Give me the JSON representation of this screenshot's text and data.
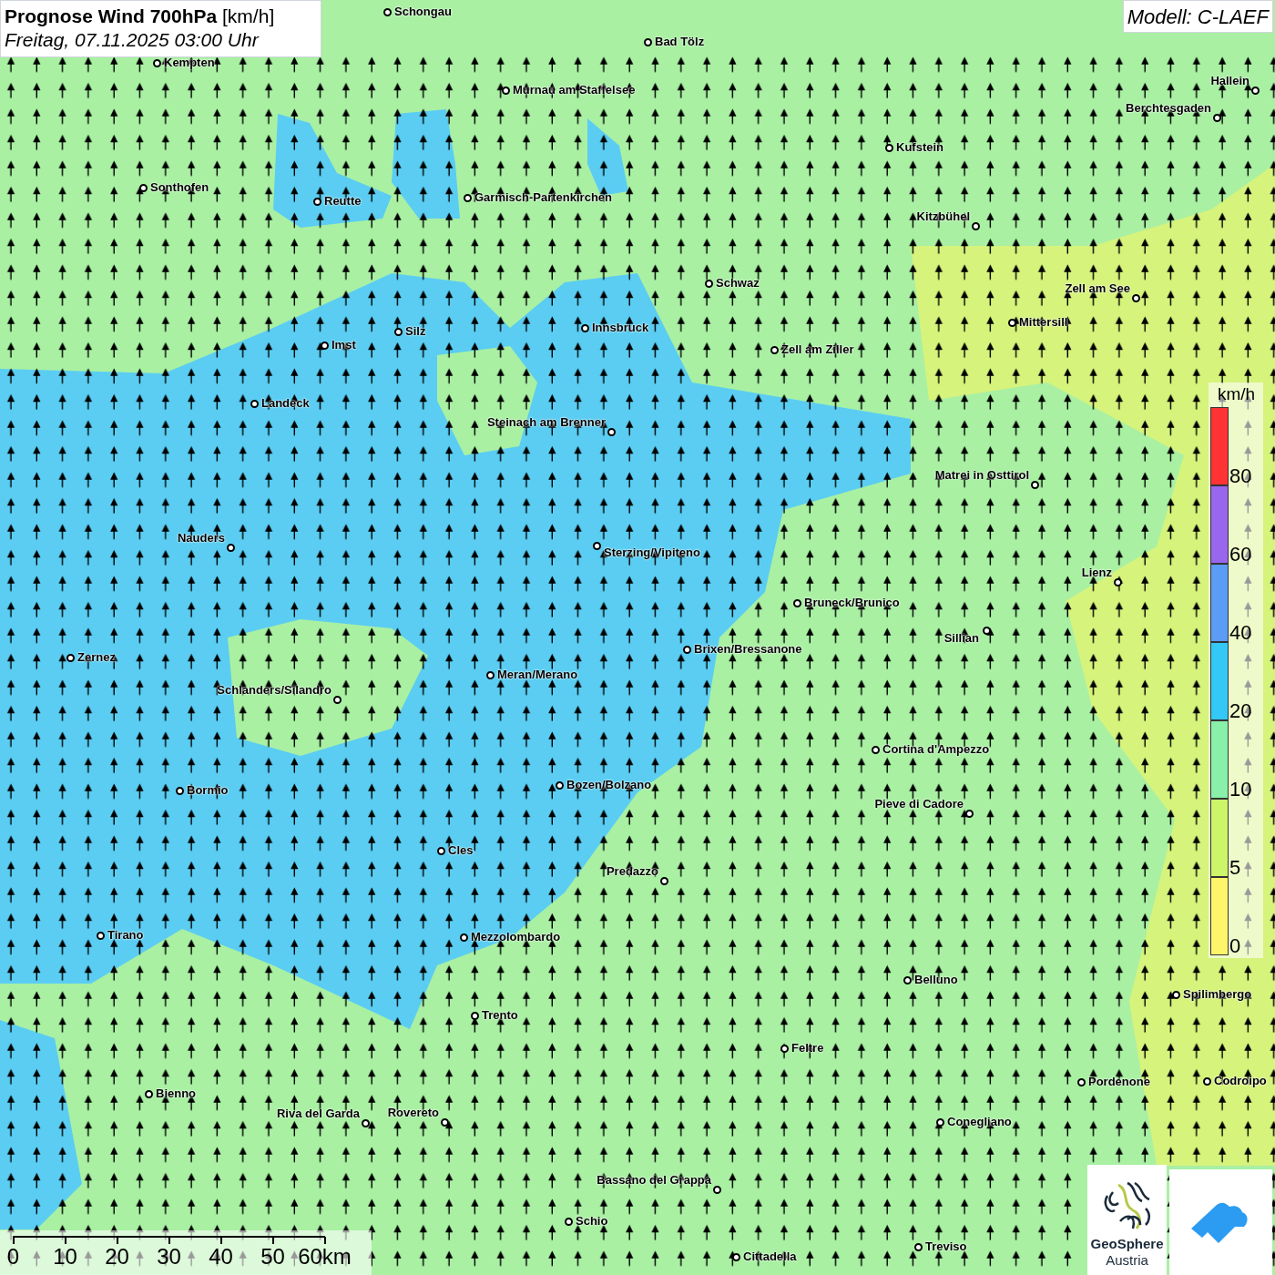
{
  "title": "**Prognose Wind 700hPa** [km/h]",
  "subtitle": "Freitag, 07.11.2025 03:00 Uhr",
  "model": "Modell: C-LAEF",
  "places": [
    {
      "name": "Schongau"
    },
    {
      "name": "Bad Tölz"
    },
    {
      "name": "Kempten"
    },
    {
      "name": "Murnau am Staffelsee"
    },
    {
      "name": "Hallein"
    },
    {
      "name": "Berchtesgaden"
    },
    {
      "name": "Kufstein"
    },
    {
      "name": "Sonthofen"
    },
    {
      "name": "Reutte"
    },
    {
      "name": "Garmisch-Partenkirchen"
    },
    {
      "name": "Kitzbühel"
    },
    {
      "name": "Schwaz"
    },
    {
      "name": "Zell am See"
    },
    {
      "name": "Mittersill"
    },
    {
      "name": "Silz"
    },
    {
      "name": "Innsbruck"
    },
    {
      "name": "Imst"
    },
    {
      "name": "Zell am Ziller"
    },
    {
      "name": "Landeck"
    },
    {
      "name": "Steinach am Brenner"
    },
    {
      "name": "Matrei in Osttirol"
    },
    {
      "name": "Nauders"
    },
    {
      "name": "Sterzing/Vipiteno"
    },
    {
      "name": "Lienz"
    },
    {
      "name": "Bruneck/Brunico"
    },
    {
      "name": "Sillian"
    },
    {
      "name": "Brixen/Bressanone"
    },
    {
      "name": "Zernez"
    },
    {
      "name": "Meran/Merano"
    },
    {
      "name": "Schlanders/Silandro"
    },
    {
      "name": "Cortina d'Ampezzo"
    },
    {
      "name": "Bozen/Bolzano"
    },
    {
      "name": "Bormio"
    },
    {
      "name": "Pieve di Cadore"
    },
    {
      "name": "Cles"
    },
    {
      "name": "Predazzo"
    },
    {
      "name": "Tirano"
    },
    {
      "name": "Mezzolombardo"
    },
    {
      "name": "Belluno"
    },
    {
      "name": "Spilimbergo"
    },
    {
      "name": "Trento"
    },
    {
      "name": "Feltre"
    },
    {
      "name": "Pordenone"
    },
    {
      "name": "Codroipo"
    },
    {
      "name": "Bienno"
    },
    {
      "name": "Riva del Garda"
    },
    {
      "name": "Rovereto"
    },
    {
      "name": "Conegliano"
    },
    {
      "name": "Bassano del Grappa"
    },
    {
      "name": "Schio"
    },
    {
      "name": "Treviso"
    },
    {
      "name": "Cittadella"
    }
  ],
  "legend": {
    "unit": "km/h",
    "items": [
      {
        "label": "80",
        "color": "#ff3333"
      },
      {
        "label": "60",
        "color": "#9966ee"
      },
      {
        "label": "40",
        "color": "#5b9cf5"
      },
      {
        "label": "20",
        "color": "#33c8f5"
      },
      {
        "label": "10",
        "color": "#88f0a8"
      },
      {
        "label": "5",
        "color": "#ccf56a"
      },
      {
        "label": "0",
        "color": "#fff56a"
      }
    ]
  },
  "scale_bar": {
    "ticks": [
      "0",
      "10",
      "20",
      "30",
      "40",
      "50",
      "60km"
    ]
  },
  "logo": {
    "line_1": "GeoSphere",
    "line_2": "Austria"
  }
}
